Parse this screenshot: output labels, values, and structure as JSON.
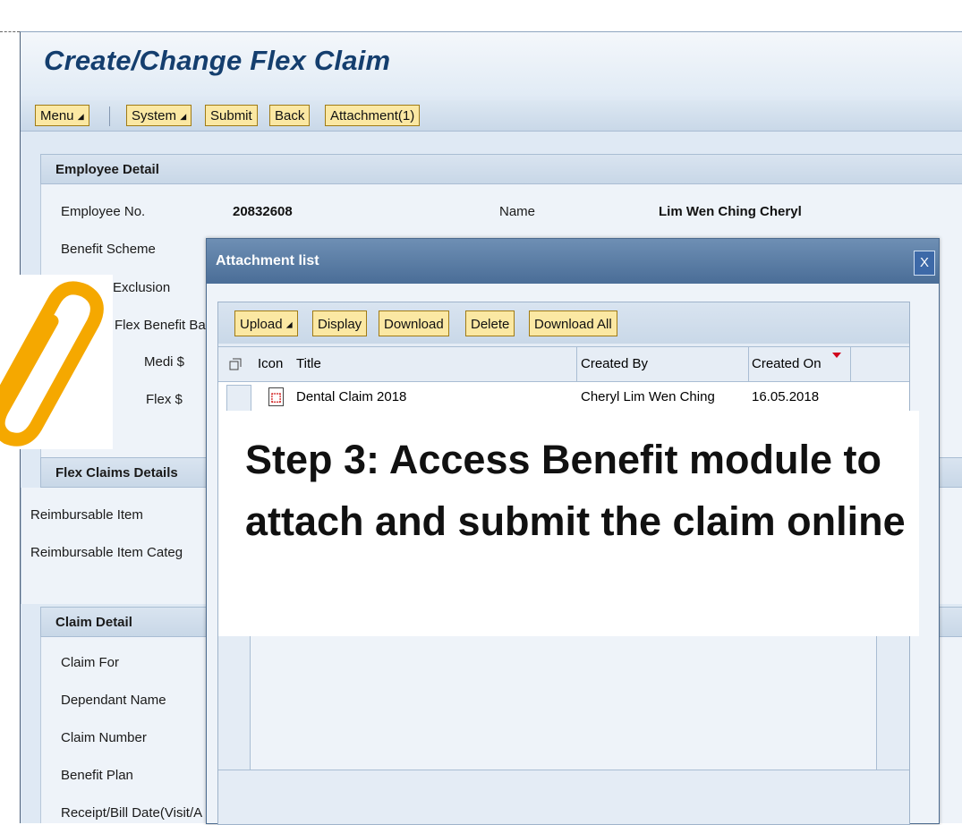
{
  "page": {
    "title": "Create/Change Flex Claim"
  },
  "toolbar": {
    "menu_label": "Menu",
    "system_label": "System",
    "submit_label": "Submit",
    "back_label": "Back",
    "attachment_label": "Attachment(1)",
    "dropdown_glyph": "◢"
  },
  "employee_detail": {
    "header": "Employee Detail",
    "employee_no_label": "Employee No.",
    "employee_no_value": "20832608",
    "name_label": "Name",
    "name_value": "Lim Wen Ching Cheryl",
    "benefit_scheme_label": "Benefit Scheme",
    "exclusion_label": "Exclusion",
    "flex_benefit_label": "Flex Benefit Ba",
    "medi_label": "Medi $",
    "flex_label": "Flex $"
  },
  "flex_claims_details": {
    "header": "Flex Claims Details",
    "reimbursable_item_label": "Reimbursable Item",
    "reimbursable_category_label": "Reimbursable Item Categ"
  },
  "claim_detail": {
    "header": "Claim Detail",
    "claim_for_label": "Claim For",
    "dependant_name_label": "Dependant Name",
    "claim_number_label": "Claim Number",
    "benefit_plan_label": "Benefit Plan",
    "receipt_date_label": "Receipt/Bill Date(Visit/A"
  },
  "attachment_dialog": {
    "title": "Attachment list",
    "close_glyph": "X",
    "buttons": {
      "upload": "Upload",
      "display": "Display",
      "download": "Download",
      "delete": "Delete",
      "download_all": "Download All"
    },
    "columns": {
      "icon": "Icon",
      "title": "Title",
      "created_by": "Created By",
      "created_on": "Created On"
    },
    "rows": [
      {
        "title": "Dental Claim 2018",
        "created_by": "Cheryl Lim Wen Ching",
        "created_on": "16.05.2018"
      }
    ]
  },
  "callout": {
    "text": "Step 3: Access Benefit module to attach and submit the claim online"
  },
  "colors": {
    "sap_title": "#143e6e",
    "button_bg": "#fbe8a3",
    "clip_orange": "#f5a800",
    "dialog_header": "#4a6d97"
  },
  "icons": [
    "paperclip-icon",
    "pdf-icon",
    "close-icon",
    "select-all-icon",
    "sort-desc-icon"
  ]
}
